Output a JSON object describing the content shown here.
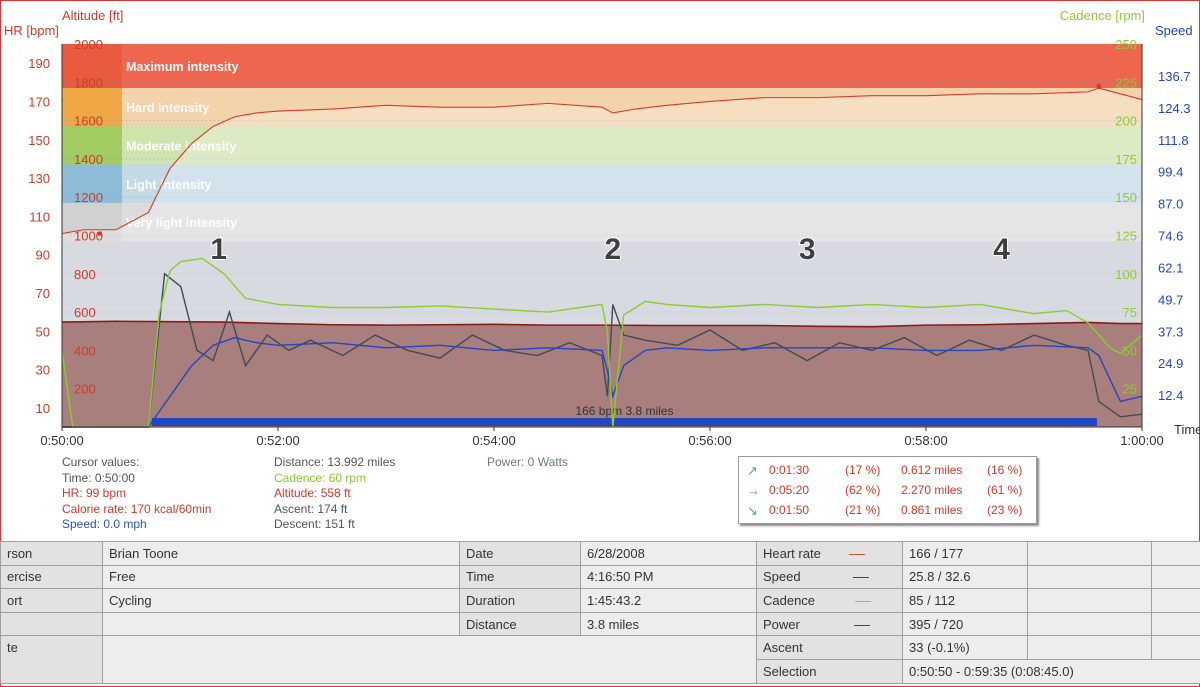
{
  "chart_data": {
    "type": "line",
    "title": "",
    "axes": {
      "left_outer": {
        "label": "HR [bpm]",
        "ticks": [
          10,
          30,
          50,
          70,
          90,
          110,
          130,
          150,
          170,
          190
        ],
        "range": [
          0,
          200
        ]
      },
      "left_inner": {
        "label": "Altitude [ft]",
        "ticks": [
          200,
          400,
          600,
          800,
          1000,
          1200,
          1400,
          1600,
          1800,
          2000
        ],
        "range": [
          0,
          2000
        ]
      },
      "right_inner": {
        "label": "Cadence [rpm]",
        "ticks": [
          25,
          50,
          75,
          100,
          125,
          150,
          175,
          200,
          225,
          250
        ],
        "range": [
          0,
          250
        ]
      },
      "right_outer": {
        "label": "Speed",
        "ticks": [
          "12.4",
          "24.9",
          "37.3",
          "49.7",
          "62.1",
          "74.6",
          "87.0",
          "99.4",
          "111.8",
          "124.3",
          "136.7"
        ],
        "range": [
          0,
          150
        ]
      },
      "x": {
        "label": "Time",
        "ticks": [
          "0:50:00",
          "0:52:00",
          "0:54:00",
          "0:56:00",
          "0:58:00",
          "1:00:00"
        ],
        "range_minutes": [
          50,
          60
        ]
      }
    },
    "zones": [
      {
        "name": "Maximum intensity",
        "hr_from": 177,
        "hr_to": 200,
        "color": "#ee6650"
      },
      {
        "name": "Hard intensity",
        "hr_from": 157,
        "hr_to": 177,
        "color": "#f3d3a9"
      },
      {
        "name": "Moderate intensity",
        "hr_from": 137,
        "hr_to": 157,
        "color": "#cfe3af"
      },
      {
        "name": "Light intensity",
        "hr_from": 117,
        "hr_to": 137,
        "color": "#c3d9e6"
      },
      {
        "name": "Very light intensity",
        "hr_from": 97,
        "hr_to": 117,
        "color": "#dcdcdc"
      }
    ],
    "lap_labels": [
      {
        "text": "1",
        "t": 51.45
      },
      {
        "text": "2",
        "t": 55.1
      },
      {
        "text": "3",
        "t": 56.9
      },
      {
        "text": "4",
        "t": 58.7
      }
    ],
    "selection_label": "166 bpm 3.8 miles",
    "selection_range": [
      50.833,
      59.583
    ],
    "series": [
      {
        "name": "Heart rate",
        "color": "#d83a2a",
        "axis": "left_outer",
        "x": [
          50,
          50.2,
          50.5,
          50.8,
          51,
          51.2,
          51.4,
          51.6,
          51.8,
          52,
          52.5,
          53,
          53.5,
          54,
          54.5,
          55,
          55.1,
          55.3,
          55.6,
          56,
          56.5,
          57,
          57.5,
          58,
          58.5,
          59,
          59.5,
          59.6,
          59.8,
          60
        ],
        "y": [
          101,
          103,
          103,
          112,
          135,
          148,
          157,
          162,
          164,
          165,
          166,
          168,
          167,
          167,
          169,
          167,
          164,
          166,
          168,
          170,
          172,
          172,
          173,
          173,
          174,
          174,
          175,
          177,
          174,
          171
        ]
      },
      {
        "name": "Altitude",
        "color": "#8a1a1a",
        "axis": "left_inner",
        "x": [
          50,
          50.5,
          51,
          51.5,
          52,
          52.5,
          53,
          53.5,
          54,
          54.5,
          55,
          55.5,
          56,
          56.5,
          57,
          57.5,
          58,
          58.5,
          59,
          59.5,
          59.8,
          60
        ],
        "y": [
          548,
          552,
          550,
          548,
          540,
          534,
          532,
          534,
          536,
          532,
          532,
          530,
          530,
          530,
          526,
          524,
          532,
          534,
          540,
          546,
          540,
          540
        ]
      },
      {
        "name": "Cadence",
        "color": "#8dcc30",
        "axis": "right_inner",
        "x": [
          50,
          50.1,
          50.8,
          50.9,
          51,
          51.1,
          51.3,
          51.5,
          51.7,
          52,
          52.5,
          53,
          53.5,
          54,
          54.5,
          55,
          55.05,
          55.1,
          55.2,
          55.4,
          55.6,
          56,
          56.5,
          57,
          57.5,
          58,
          58.5,
          59,
          59.3,
          59.5,
          59.7,
          59.8,
          60
        ],
        "y": [
          50,
          0,
          0,
          74,
          102,
          108,
          110,
          100,
          84,
          80,
          78,
          78,
          79,
          77,
          75,
          80,
          62,
          0,
          73,
          82,
          80,
          78,
          80,
          78,
          80,
          78,
          80,
          74,
          76,
          68,
          52,
          48,
          60
        ]
      },
      {
        "name": "Speed",
        "color": "#2346c4",
        "axis": "right_outer",
        "x": [
          50,
          50.8,
          51,
          51.2,
          51.4,
          51.6,
          51.8,
          52,
          52.5,
          53,
          53.5,
          54,
          54.5,
          55,
          55.05,
          55.1,
          55.2,
          55.4,
          55.6,
          56,
          56.5,
          57,
          57.5,
          58,
          58.5,
          59,
          59.5,
          59.6,
          59.8,
          60
        ],
        "y": [
          0,
          0,
          12,
          24,
          32,
          35,
          33,
          32,
          33,
          31,
          32,
          30,
          31,
          30,
          22,
          12,
          24,
          30,
          31,
          30,
          31,
          31,
          31,
          30,
          30,
          32,
          31,
          28,
          10,
          12
        ]
      },
      {
        "name": "Power",
        "color": "#404a56",
        "axis": "right_outer",
        "x": [
          50,
          50.8,
          50.95,
          51.1,
          51.25,
          51.4,
          51.55,
          51.7,
          51.9,
          52.1,
          52.3,
          52.6,
          52.9,
          53.2,
          53.5,
          53.8,
          54.1,
          54.4,
          54.7,
          55,
          55.05,
          55.1,
          55.2,
          55.4,
          55.7,
          56,
          56.3,
          56.6,
          56.9,
          57.2,
          57.5,
          57.8,
          58.1,
          58.4,
          58.7,
          59,
          59.3,
          59.5,
          59.6,
          59.8,
          60
        ],
        "y": [
          0,
          0,
          60,
          55,
          30,
          26,
          45,
          24,
          36,
          30,
          34,
          28,
          36,
          30,
          27,
          36,
          30,
          28,
          33,
          28,
          12,
          48,
          36,
          34,
          32,
          38,
          30,
          33,
          26,
          33,
          30,
          35,
          28,
          34,
          30,
          36,
          32,
          30,
          10,
          4,
          5
        ]
      }
    ]
  },
  "cursor": {
    "title": "Cursor values:",
    "time": "Time: 0:50:00",
    "hr": "HR: 99 bpm",
    "calorie": "Calorie rate: 170 kcal/60min",
    "speed": "Speed: 0.0 mph",
    "distance": "Distance: 13.992 miles",
    "cadence": "Cadence: 60 rpm",
    "altitude": "Altitude: 558 ft",
    "ascent": "Ascent: 174 ft",
    "descent": "Descent: 151 ft",
    "power": "Power: 0 Watts"
  },
  "slope_summary": [
    {
      "icon": "arrow-up-right-icon",
      "glyph": "↗",
      "time": "0:01:30",
      "pct": "(17 %)",
      "dist": "0.612 miles",
      "dpct": "(16 %)"
    },
    {
      "icon": "arrow-right-icon",
      "glyph": "→",
      "time": "0:05:20",
      "pct": "(62 %)",
      "dist": "2.270 miles",
      "dpct": "(61 %)"
    },
    {
      "icon": "arrow-down-right-icon",
      "glyph": "↘",
      "time": "0:01:50",
      "pct": "(21 %)",
      "dist": "0.861 miles",
      "dpct": "(23 %)"
    }
  ],
  "summary": {
    "person_label": "rson",
    "person": "Brian Toone",
    "exercise_label": "ercise",
    "exercise": "Free",
    "sport_label": "ort",
    "sport": "Cycling",
    "note_label": "te",
    "date_label": "Date",
    "date": "6/28/2008",
    "time_label": "Time",
    "time": "4:16:50 PM",
    "duration_label": "Duration",
    "duration": "1:45:43.2",
    "distance_label": "Distance",
    "distance": "3.8 miles",
    "hr_label": "Heart rate",
    "hr": "166 / 177",
    "speed_label": "Speed",
    "speed": "25.8 / 32.6",
    "cadence_label": "Cadence",
    "cadence": "85 / 112",
    "power_label": "Power",
    "power": "395 / 720",
    "ascent_label": "Ascent",
    "ascent": "33 (-0.1%)",
    "selection_label": "Selection",
    "selection": "0:50:50 - 0:59:35 (0:08:45.0)",
    "colors": {
      "hr": "#e05030",
      "speed": "#2346c4",
      "cadence": "#8dcc30",
      "power": "#404a56"
    }
  }
}
